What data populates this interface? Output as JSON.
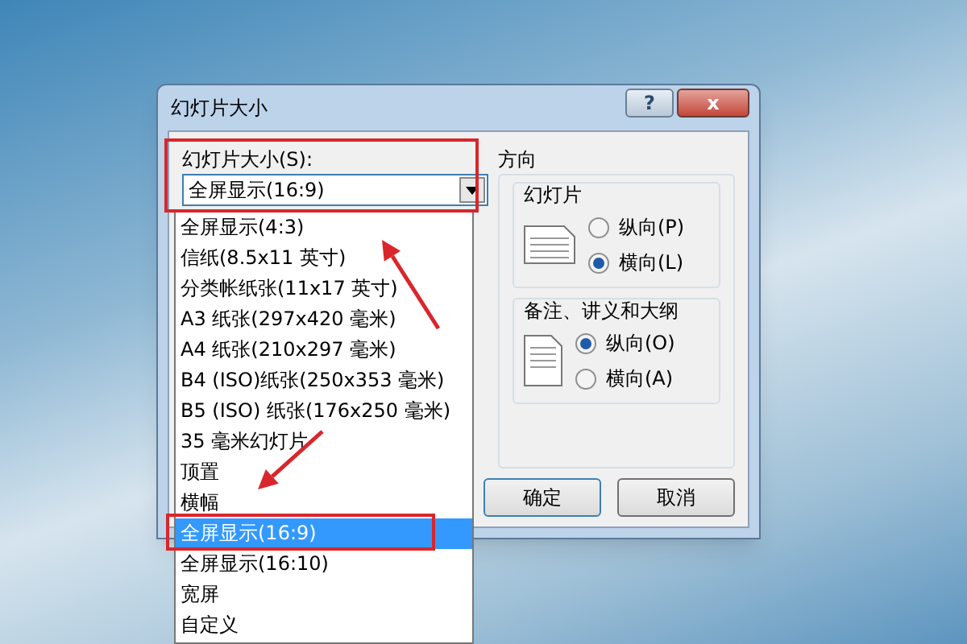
{
  "window": {
    "title": "幻灯片大小",
    "buttons": [
      "?",
      "x"
    ]
  },
  "size": {
    "label": "幻灯片大小(S):",
    "value": "全屏显示(16:9)",
    "expanded": true,
    "options": [
      {
        "label": "全屏显示(4:3)",
        "selected": false
      },
      {
        "label": "信纸(8.5x11 英寸)",
        "selected": false
      },
      {
        "label": "分类帐纸张(11x17 英寸)",
        "selected": false
      },
      {
        "label": "A3 纸张(297x420 毫米)",
        "selected": false
      },
      {
        "label": "A4 纸张(210x297 毫米)",
        "selected": false
      },
      {
        "label": "B4 (ISO)纸张(250x353 毫米)",
        "selected": false
      },
      {
        "label": "B5 (ISO) 纸张(176x250 毫米)",
        "selected": false
      },
      {
        "label": "35 毫米幻灯片",
        "selected": false
      },
      {
        "label": "顶置",
        "selected": false
      },
      {
        "label": "横幅",
        "selected": false
      },
      {
        "label": "全屏显示(16:9)",
        "selected": true
      },
      {
        "label": "全屏显示(16:10)",
        "selected": false
      },
      {
        "label": "宽屏",
        "selected": false
      },
      {
        "label": "自定义",
        "selected": false
      }
    ]
  },
  "orientation": {
    "title": "方向",
    "groups": [
      {
        "title": "幻灯片",
        "options": [
          {
            "label": "纵向(P)",
            "selected": false
          },
          {
            "label": "横向(L)",
            "selected": true
          }
        ]
      },
      {
        "title": "备注、讲义和大纲",
        "options": [
          {
            "label": "纵向(O)",
            "selected": true
          },
          {
            "label": "横向(A)",
            "selected": false
          }
        ]
      }
    ]
  },
  "buttons": [
    "确定",
    "取消"
  ],
  "annotations": [
    {
      "kind": "box"
    },
    {
      "kind": "box"
    },
    {
      "kind": "arrow"
    },
    {
      "kind": "arrow"
    }
  ]
}
